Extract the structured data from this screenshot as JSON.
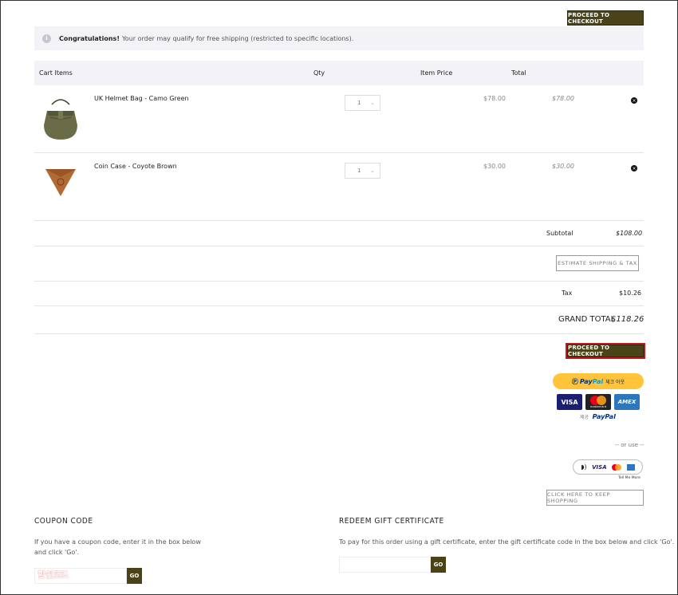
{
  "checkout_label": "PROCEED TO CHECKOUT",
  "notice": {
    "bold": "Congratulations!",
    "text": "Your order may qualify for free shipping (restricted to specific locations)."
  },
  "table_headers": {
    "items": "Cart Items",
    "qty": "Qty",
    "price": "Item Price",
    "total": "Total"
  },
  "items": [
    {
      "name": "UK Helmet Bag - Camo Green",
      "qty": "1",
      "price": "$78.00",
      "total": "$78.00"
    },
    {
      "name": "Coin Case - Coyote Brown",
      "qty": "1",
      "price": "$30.00",
      "total": "$30.00"
    }
  ],
  "summary": {
    "subtotal_label": "Subtotal",
    "subtotal": "$108.00",
    "estimate_label": "ESTIMATE SHIPPING & TAX",
    "tax_label": "Tax",
    "tax": "$10.26",
    "grand_label": "GRAND TOTAL",
    "grand": "$118.26"
  },
  "paypal": {
    "pay": "Pay",
    "pal": "Pal",
    "korean": "체크 아웃",
    "powered_prefix": "제공",
    "powered_brand": "PayPal"
  },
  "cards": [
    "VISA",
    "mastercard",
    "AMEX"
  ],
  "or_use": "-- or use --",
  "wallet": {
    "visa": "VISA",
    "tell_me": "Tell Me More"
  },
  "keep_shopping": "CLICK HERE TO KEEP SHOPPING",
  "coupon": {
    "title": "COUPON CODE",
    "text1": "If you have a coupon code, enter it in the box below",
    "text2": "and click 'Go'.",
    "overlay": "할인코드",
    "go": "GO"
  },
  "gift": {
    "title": "REDEEM GIFT CERTIFICATE",
    "text": "To pay for this order using a gift certificate, enter the gift certificate code in the box below and click 'Go'.",
    "go": "GO"
  },
  "colors": {
    "accent": "#4a4318",
    "paypal_yellow": "#ffc439",
    "highlight": "#c0171e"
  }
}
